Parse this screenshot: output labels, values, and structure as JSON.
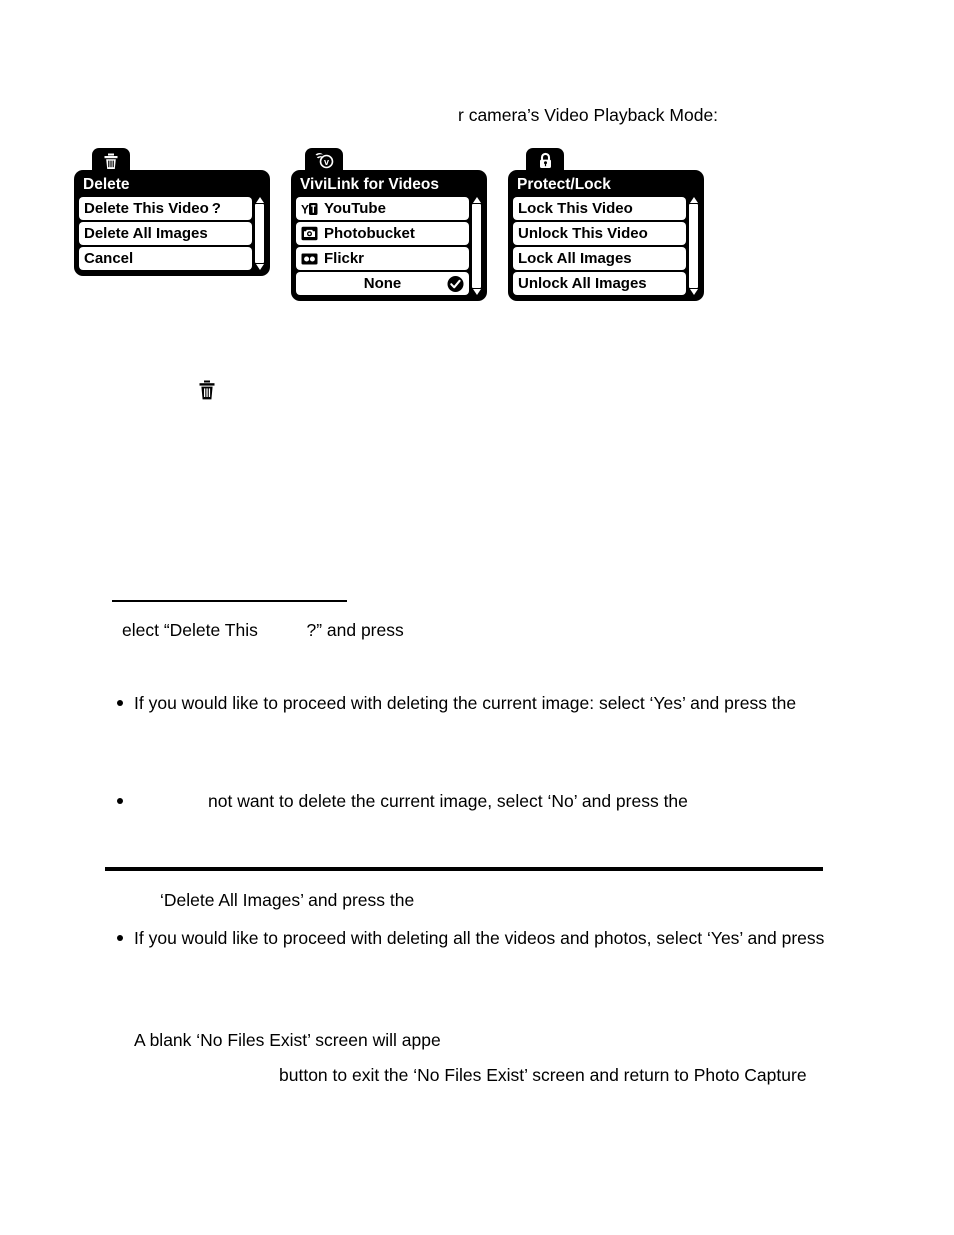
{
  "document": {
    "intro_line": "r camera’s Video Playback Mode:",
    "select_delete_line": "elect “Delete This          ?” and press",
    "delete_all_line": "‘Delete All Images’ and press the",
    "blank_no_files_line": "A blank ‘No Files Exist’ screen will appe",
    "button_exit_line": "button to exit the ‘No Files Exist’ screen and return to Photo Capture",
    "bullets": [
      "If you would like to proceed with deleting the current image: select ‘Yes’ and press the",
      "not want to delete the current image, select ‘No’ and press the",
      "If you would like to proceed with deleting all the videos and photos, select ‘Yes’ and press"
    ],
    "mid_icon": "trash-icon"
  },
  "menus": [
    {
      "id": "delete",
      "tab_icon": "trash-icon",
      "title": "Delete",
      "scrollbar": true,
      "rows": [
        {
          "label": "Delete This Video ?",
          "icon": null,
          "checked": false,
          "center": false
        },
        {
          "label": "Delete All Images",
          "icon": null,
          "checked": false,
          "center": false
        },
        {
          "label": "Cancel",
          "icon": null,
          "checked": false,
          "center": false
        }
      ]
    },
    {
      "id": "vivilink",
      "tab_icon": "vivilink-icon",
      "title": "ViviLink for Videos",
      "scrollbar": true,
      "rows": [
        {
          "label": "YouTube",
          "icon": "youtube-icon",
          "checked": false,
          "center": false
        },
        {
          "label": "Photobucket",
          "icon": "photobucket-icon",
          "checked": false,
          "center": false
        },
        {
          "label": "Flickr",
          "icon": "flickr-icon",
          "checked": false,
          "center": false
        },
        {
          "label": "None",
          "icon": null,
          "checked": true,
          "center": true
        }
      ]
    },
    {
      "id": "protect",
      "tab_icon": "lock-icon",
      "title": "Protect/Lock",
      "scrollbar": true,
      "rows": [
        {
          "label": "Lock This Video",
          "icon": null,
          "checked": false,
          "center": false
        },
        {
          "label": "Unlock This Video",
          "icon": null,
          "checked": false,
          "center": false
        },
        {
          "label": "Lock All Images",
          "icon": null,
          "checked": false,
          "center": false
        },
        {
          "label": "Unlock All Images",
          "icon": null,
          "checked": false,
          "center": false
        }
      ]
    }
  ],
  "colors": {
    "panel_background": "#000000",
    "row_background": "#ffffff",
    "text": "#000000",
    "page_background": "#ffffff"
  }
}
